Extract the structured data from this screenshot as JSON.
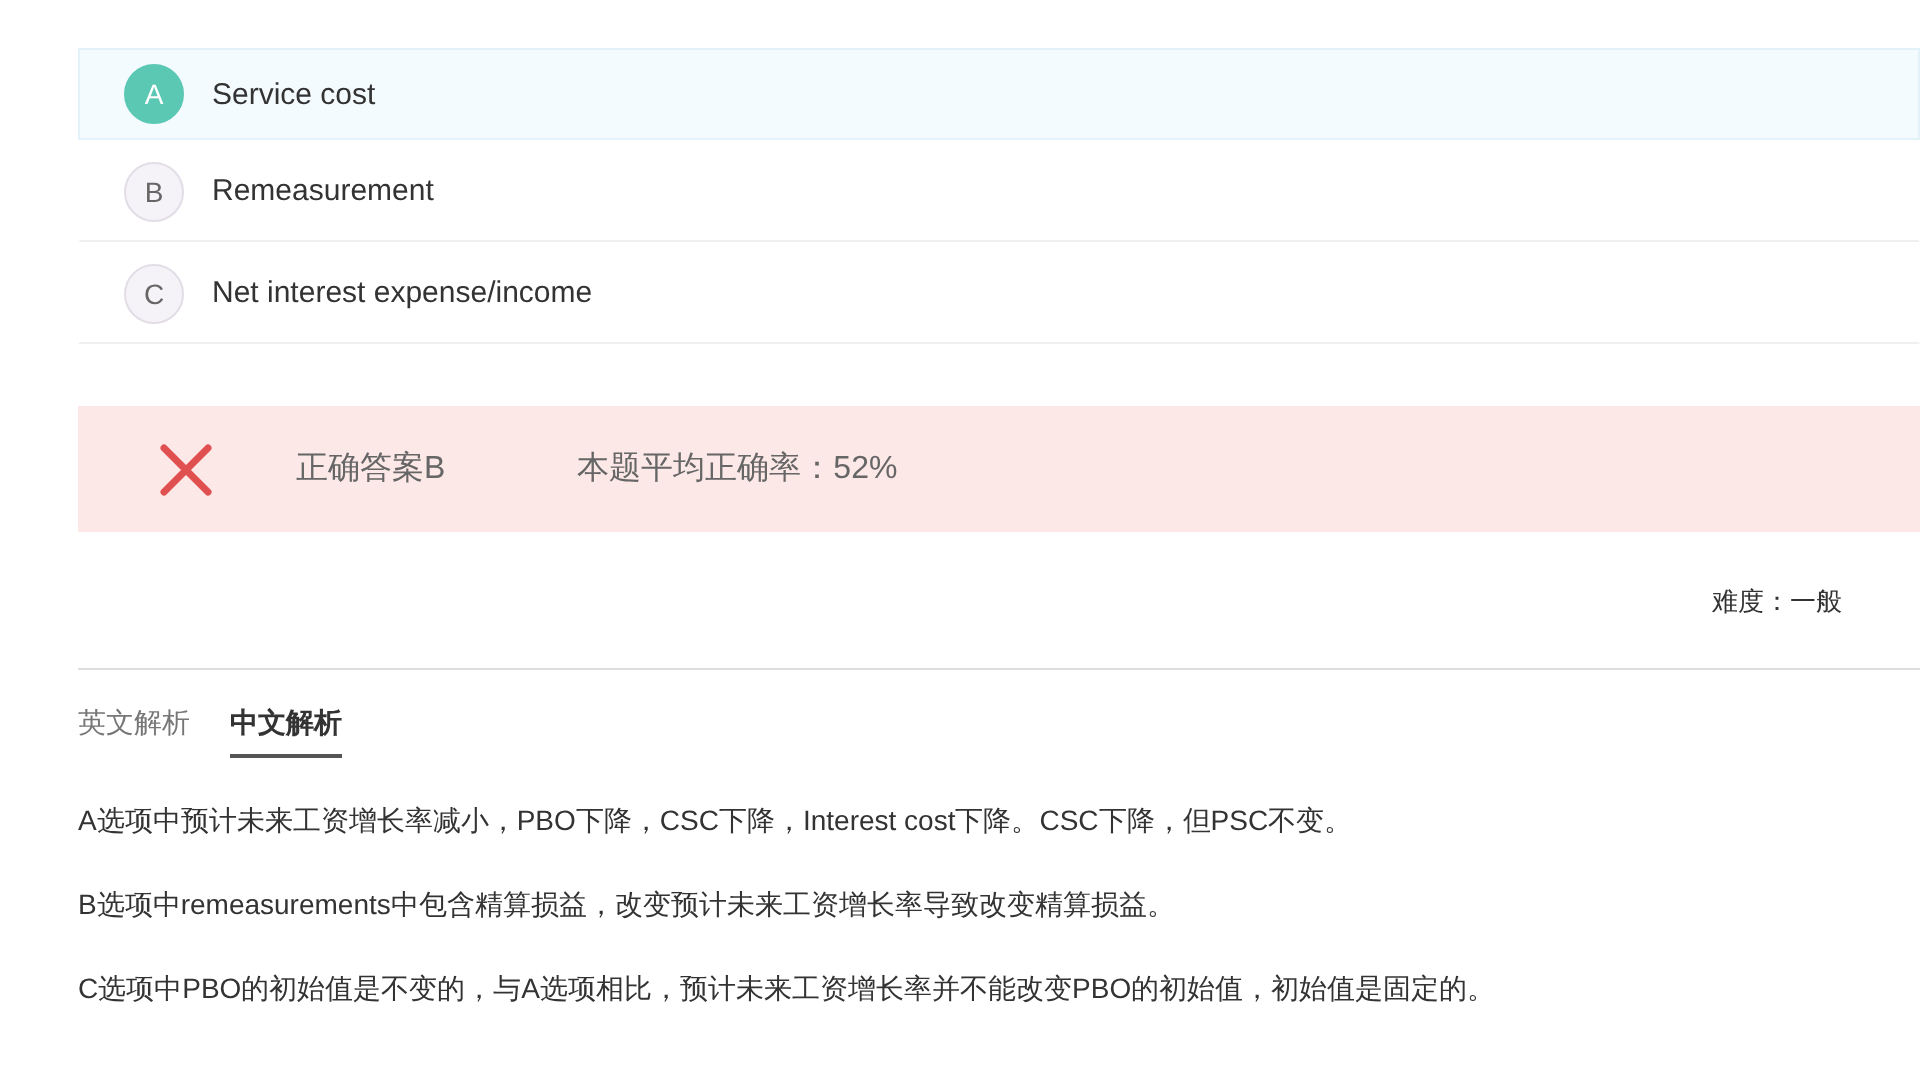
{
  "options": [
    {
      "letter": "A",
      "text": "Service cost",
      "selected": true
    },
    {
      "letter": "B",
      "text": "Remeasurement",
      "selected": false
    },
    {
      "letter": "C",
      "text": "Net interest expense/income",
      "selected": false
    }
  ],
  "result": {
    "correct": false,
    "answer": "正确答案B",
    "average": "本题平均正确率：52%"
  },
  "difficulty": "难度：一般",
  "tabs": [
    {
      "label": "英文解析",
      "selected": false
    },
    {
      "label": "中文解析",
      "selected": true
    }
  ],
  "paragraphs": [
    "A选项中预计未来工资增长率减小，PBO下降，CSC下降，Interest cost下降。CSC下降，但PSC不变。",
    "B选项中remeasurements中包含精算损益，改变预计未来工资增长率导致改变精算损益。",
    "C选项中PBO的初始值是不变的，与A选项相比，预计未来工资增长率并不能改变PBO的初始值，初始值是固定的。"
  ]
}
